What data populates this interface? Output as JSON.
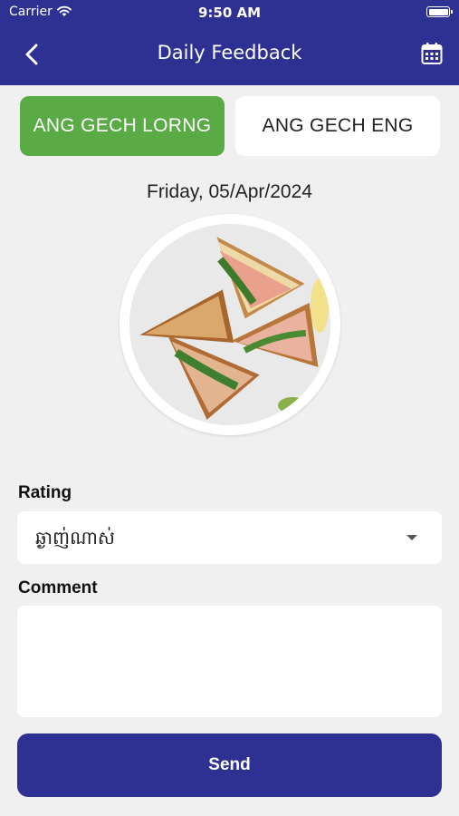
{
  "status_bar": {
    "carrier": "Carrier",
    "time": "9:50 AM"
  },
  "nav": {
    "title": "Daily Feedback",
    "back_icon": "chevron-left-icon",
    "calendar_icon": "calendar-icon"
  },
  "tabs": [
    {
      "label": "ANG GECH LORNG",
      "selected": true
    },
    {
      "label": "ANG GECH ENG",
      "selected": false
    }
  ],
  "date": "Friday, 05/Apr/2024",
  "rating": {
    "label": "Rating",
    "value": "ឆ្ងាញ់ណាស់"
  },
  "comment": {
    "label": "Comment",
    "value": "",
    "placeholder": ""
  },
  "send_label": "Send",
  "colors": {
    "primary": "#2e3192",
    "selected_tab": "#5aaa46",
    "background": "#f0f0f0"
  }
}
